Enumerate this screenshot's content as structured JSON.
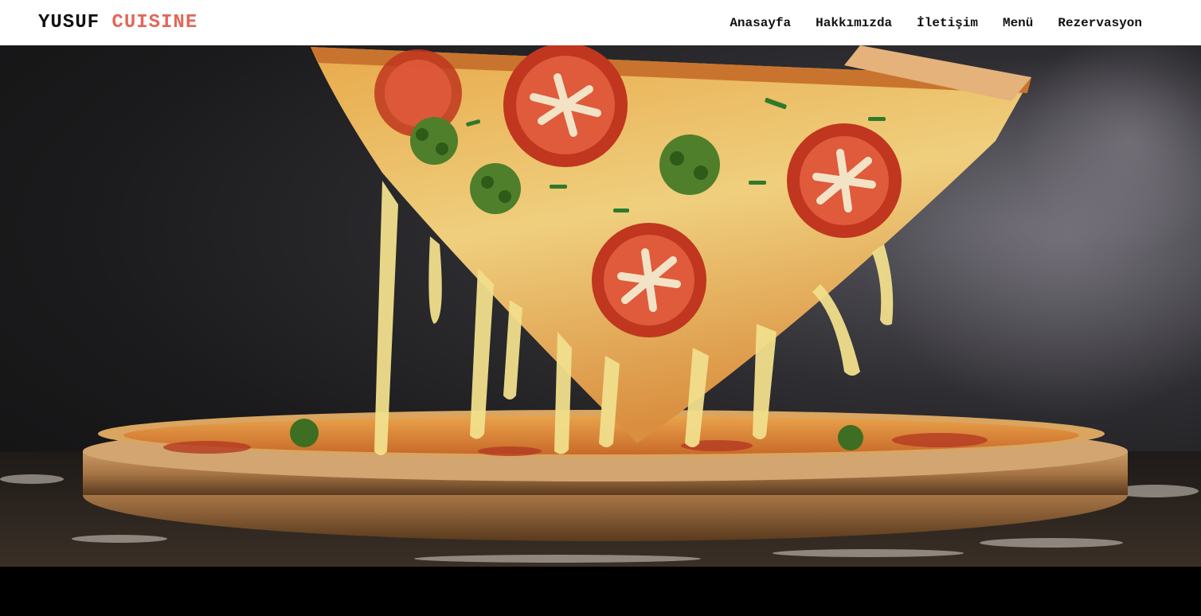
{
  "brand": {
    "name_first": "YUSUF",
    "name_second": "CUISINE",
    "accent_color": "#e0685a"
  },
  "nav": {
    "items": [
      {
        "label": "Anasayfa"
      },
      {
        "label": "Hakkımızda"
      },
      {
        "label": "İletişim"
      },
      {
        "label": "Menü"
      },
      {
        "label": "Rezervasyon"
      }
    ]
  },
  "hero": {
    "image": "pizza-slice-cheese-pull-photo"
  }
}
